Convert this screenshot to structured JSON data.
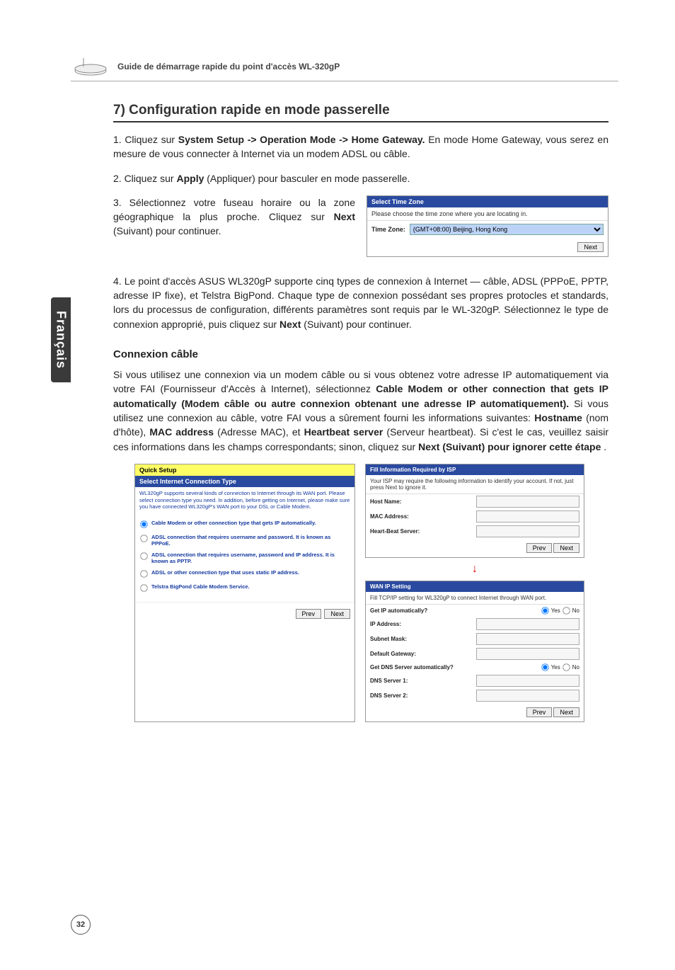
{
  "header": {
    "guide_title": "Guide de démarrage rapide du point d'accès WL-320gP"
  },
  "side_tab": "Français",
  "section_title": "7) Configuration rapide en mode passerelle",
  "step1_prefix": "1. Cliquez sur ",
  "step1_bold": "System Setup -> Operation Mode -> Home Gateway.",
  "step1_suffix": " En mode Home Gateway, vous serez en mesure de vous connecter à Internet via un modem ADSL ou câble.",
  "step2_prefix": "2. Cliquez sur ",
  "step2_bold": "Apply",
  "step2_suffix": " (Appliquer) pour basculer en mode passerelle.",
  "step3_prefix": "3. Sélectionnez votre fuseau horaire ou la zone géographique la plus proche. Cliquez sur ",
  "step3_bold": "Next",
  "step3_suffix": " (Suivant) pour continuer.",
  "tz_panel": {
    "title": "Select Time Zone",
    "sub": "Please choose the time zone where you are locating in.",
    "label": "Time Zone:",
    "value": "(GMT+08:00) Beijing, Hong Kong",
    "next": "Next"
  },
  "step4_a": "4. Le point d'accès ASUS WL320gP supporte cinq types de connexion à Internet — câble, ADSL (PPPoE, PPTP, adresse IP fixe), et Telstra BigPond. Chaque type de connexion possédant ses propres protocles et standards, lors du processus de configuration, différents paramètres sont requis par le WL-320gP. Sélectionnez le type de connexion approprié, puis cliquez sur ",
  "step4_bold": "Next",
  "step4_b": " (Suivant) pour continuer.",
  "sub_title": "Connexion câble",
  "cable_para_a": "Si vous utilisez une connexion via un modem câble ou si vous obtenez votre adresse IP automatiquement via votre FAI (Fournisseur d'Accès à Internet), sélectionnez ",
  "cable_b1": "Cable Modem or other connection that gets IP automatically (Modem câble ou autre connexion obtenant une adresse IP automatiquement).",
  "cable_para_b": " Si vous utilisez une connexion au câble, votre FAI vous a sûrement fourni les informations suivantes: ",
  "cable_b2": "Hostname",
  "cable_para_c": " (nom d'hôte), ",
  "cable_b3": "MAC address",
  "cable_para_d": " (Adresse MAC), et ",
  "cable_b4": "Heartbeat server",
  "cable_para_e": " (Serveur heartbeat). Si c'est le cas, veuillez saisir ces informations dans les champs correspondants; sinon, cliquez sur ",
  "cable_b5": "Next (Suivant) pour ignorer cette étape",
  "cable_para_f": ".",
  "quick_setup": {
    "top": "Quick Setup",
    "head": "Select Internet Connection Type",
    "desc": "WL320gP supports several kinds of connection to Internet through its WAN port. Please select connection type you need. In addition, before getting on Internet, please make sure you have connected WL320gP's WAN port to your DSL or Cable Modem.",
    "opts": [
      "Cable Modem or other connection type that gets IP automatically.",
      "ADSL connection that requires username and password. It is known as PPPoE.",
      "ADSL connection that requires username, password and IP address. It is known as PPTP.",
      "ADSL or other connection type that uses static IP address.",
      "Telstra BigPond Cable Modem Service."
    ],
    "prev": "Prev",
    "next": "Next"
  },
  "isp_panel": {
    "title": "Fill Information Required by ISP",
    "sub": "Your ISP may require the following information to identify your account. If not, just press Next to ignore it.",
    "fields": [
      "Host Name:",
      "MAC Address:",
      "Heart-Beat Server:"
    ],
    "prev": "Prev",
    "next": "Next"
  },
  "wan_panel": {
    "title": "WAN IP Setting",
    "sub": "Fill TCP/IP setting for WL320gP to connect Internet through WAN port.",
    "get_ip": "Get IP automatically?",
    "yes": "Yes",
    "no": "No",
    "fields1": [
      "IP Address:",
      "Subnet Mask:",
      "Default Gateway:"
    ],
    "get_dns": "Get DNS Server automatically?",
    "fields2": [
      "DNS Server 1:",
      "DNS Server 2:"
    ],
    "prev": "Prev",
    "next": "Next"
  },
  "page_number": "32"
}
